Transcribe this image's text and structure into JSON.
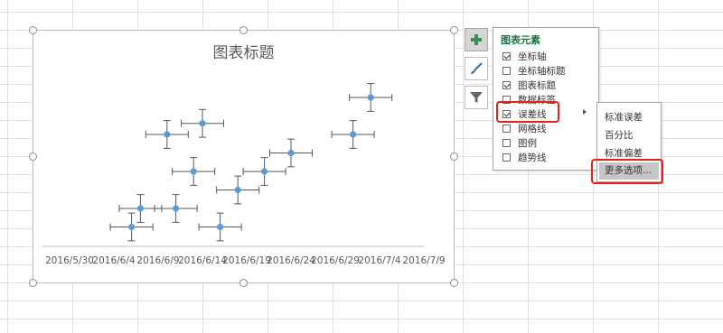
{
  "chart": {
    "title": "图表标题",
    "x_tick_labels": [
      "2016/5/30",
      "2016/6/4",
      "2016/6/9",
      "2016/6/14",
      "2016/6/19",
      "2016/6/24",
      "2016/6/29",
      "2016/7/4",
      "2016/7/9"
    ]
  },
  "chart_data": {
    "type": "scatter",
    "title": "图表标题",
    "xlabel": "",
    "ylabel": "",
    "x_axis_type": "date",
    "x_ticks": [
      "2016/5/30",
      "2016/6/4",
      "2016/6/9",
      "2016/6/14",
      "2016/6/19",
      "2016/6/24",
      "2016/6/29",
      "2016/7/4",
      "2016/7/9"
    ],
    "xlim": [
      "2016/5/30",
      "2016/7/9"
    ],
    "points": [
      {
        "x": "2016/6/6",
        "y": 1
      },
      {
        "x": "2016/6/7",
        "y": 2
      },
      {
        "x": "2016/6/11",
        "y": 2
      },
      {
        "x": "2016/6/16",
        "y": 1
      },
      {
        "x": "2016/6/18",
        "y": 3
      },
      {
        "x": "2016/6/13",
        "y": 4
      },
      {
        "x": "2016/6/21",
        "y": 4
      },
      {
        "x": "2016/6/24",
        "y": 5
      },
      {
        "x": "2016/6/10",
        "y": 6
      },
      {
        "x": "2016/6/14",
        "y": 6.6
      },
      {
        "x": "2016/7/1",
        "y": 6
      },
      {
        "x": "2016/7/3",
        "y": 8
      }
    ],
    "error_bars": {
      "x_error_days": 2.4,
      "y_error": 0.75
    },
    "marker_color": "#5b9bd5",
    "error_bar_color": "#595959",
    "legend": "none",
    "grid": false
  },
  "side_buttons": [
    {
      "icon": "plus-icon",
      "color": "#3a8f56"
    },
    {
      "icon": "brush-icon",
      "color": "#2f6db5"
    },
    {
      "icon": "filter-icon",
      "color": "#666666"
    }
  ],
  "elements_panel": {
    "title": "图表元素",
    "items": [
      {
        "label": "坐标轴",
        "checked": true
      },
      {
        "label": "坐标轴标题",
        "checked": false
      },
      {
        "label": "图表标题",
        "checked": true
      },
      {
        "label": "数据标签",
        "checked": false
      },
      {
        "label": "误差线",
        "checked": true
      },
      {
        "label": "网格线",
        "checked": false
      },
      {
        "label": "图例",
        "checked": false
      },
      {
        "label": "趋势线",
        "checked": false
      }
    ]
  },
  "error_bar_submenu": {
    "items": [
      "标准误差",
      "百分比",
      "标准偏差",
      "更多选项..."
    ],
    "hovered": "更多选项..."
  },
  "highlight_color": "#e8211c"
}
